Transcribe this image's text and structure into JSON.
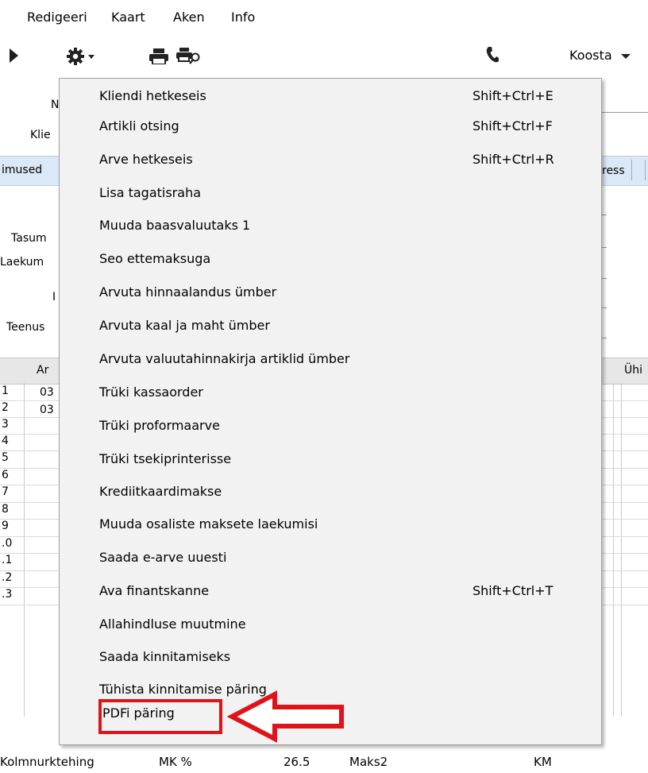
{
  "menubar": {
    "items": [
      "Redigeeri",
      "Kaart",
      "Aken",
      "Info"
    ]
  },
  "toolbar": {
    "play_icon": "play-icon",
    "gear_icon": "gear-icon",
    "print_icon": "printer-icon",
    "print_preview_icon": "print-preview-icon",
    "phone_icon": "phone-icon",
    "koosta_label": "Koosta"
  },
  "form": {
    "labels": [
      "N",
      "Klie",
      "Tasum",
      "Laekum",
      "I",
      "Teenus"
    ],
    "tab_left": "imused",
    "tab_right": "ress",
    "grid_header_left": "Ar",
    "grid_header_right": "Ühi",
    "row_numbers": [
      "1",
      "2",
      "3",
      "4",
      "5",
      "6",
      "7",
      "8",
      "9",
      ".0",
      ".1",
      ".2",
      ".3"
    ],
    "row_codes": [
      "03",
      "03"
    ]
  },
  "popup_menu": {
    "items": [
      {
        "label": "Kliendi hetkeseis",
        "shortcut": "Shift+Ctrl+E"
      },
      {
        "label": "Artikli otsing",
        "shortcut": "Shift+Ctrl+F"
      },
      {
        "label": "Arve hetkeseis",
        "shortcut": "Shift+Ctrl+R"
      },
      {
        "label": "Lisa tagatisraha",
        "shortcut": ""
      },
      {
        "label": "Muuda baasvaluutaks 1",
        "shortcut": ""
      },
      {
        "label": "Seo ettemaksuga",
        "shortcut": ""
      },
      {
        "label": "Arvuta hinnaalandus ümber",
        "shortcut": ""
      },
      {
        "label": "Arvuta kaal ja maht ümber",
        "shortcut": ""
      },
      {
        "label": "Arvuta valuutahinnakirja artiklid ümber",
        "shortcut": ""
      },
      {
        "label": "Trüki kassaorder",
        "shortcut": ""
      },
      {
        "label": "Trüki proformaarve",
        "shortcut": ""
      },
      {
        "label": "Trüki tsekiprinterisse",
        "shortcut": ""
      },
      {
        "label": "Krediitkaardimakse",
        "shortcut": ""
      },
      {
        "label": "Muuda osaliste maksete laekumisi",
        "shortcut": ""
      },
      {
        "label": "Saada e-arve uuesti",
        "shortcut": ""
      },
      {
        "label": "Ava finantskanne",
        "shortcut": "Shift+Ctrl+T"
      },
      {
        "label": "Allahindluse muutmine",
        "shortcut": ""
      },
      {
        "label": "Saada kinnitamiseks",
        "shortcut": ""
      },
      {
        "label": "Tühista kinnitamise päring",
        "shortcut": ""
      },
      {
        "label": "PDFi  päring",
        "shortcut": ""
      }
    ],
    "highlighted_item": "PDFi  päring"
  },
  "annotation": {
    "highlight_color": "#e0121a",
    "arrow_icon": "left-arrow-icon"
  },
  "statusbar": {
    "items": [
      "Kolmnurktehing",
      "MK %",
      "26.5",
      "Maks2",
      "KM"
    ]
  }
}
